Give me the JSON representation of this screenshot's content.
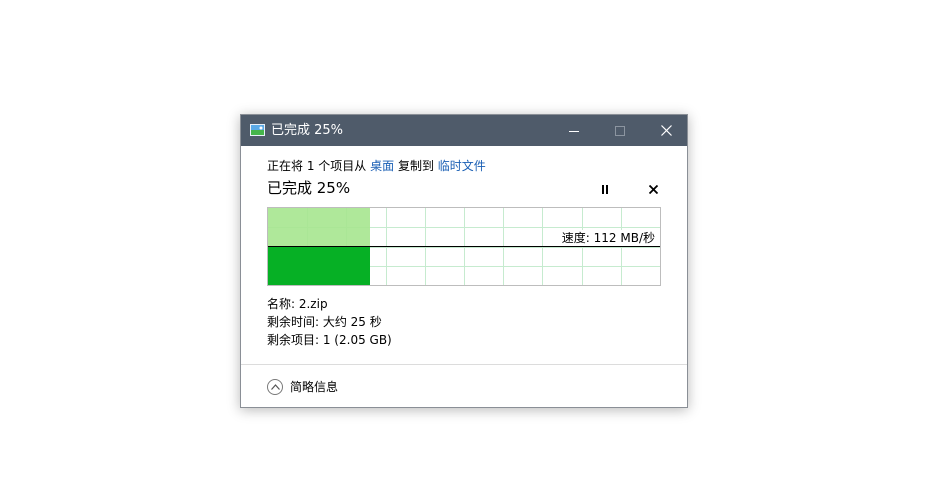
{
  "window": {
    "title": "已完成 25%",
    "icon": "file-copy-icon"
  },
  "operation": {
    "prefix": "正在将 1 个项目从",
    "source": "桌面",
    "middle": "复制到",
    "destination": "临时文件"
  },
  "progress": {
    "heading": "已完成 25%",
    "percent": 25
  },
  "speed": {
    "label": "速度: 112 MB/秒"
  },
  "details": {
    "name": "名称: 2.zip",
    "time_remaining": "剩余时间: 大约 25 秒",
    "items_remaining": "剩余项目: 1 (2.05 GB)"
  },
  "toggle": {
    "label": "简略信息"
  },
  "colors": {
    "titlebar": "#4f5b6a",
    "link": "#1a5fb4",
    "graph_fill": "#06b025",
    "graph_fill_light": "#a6e58f",
    "grid": "#c6ebcf"
  }
}
